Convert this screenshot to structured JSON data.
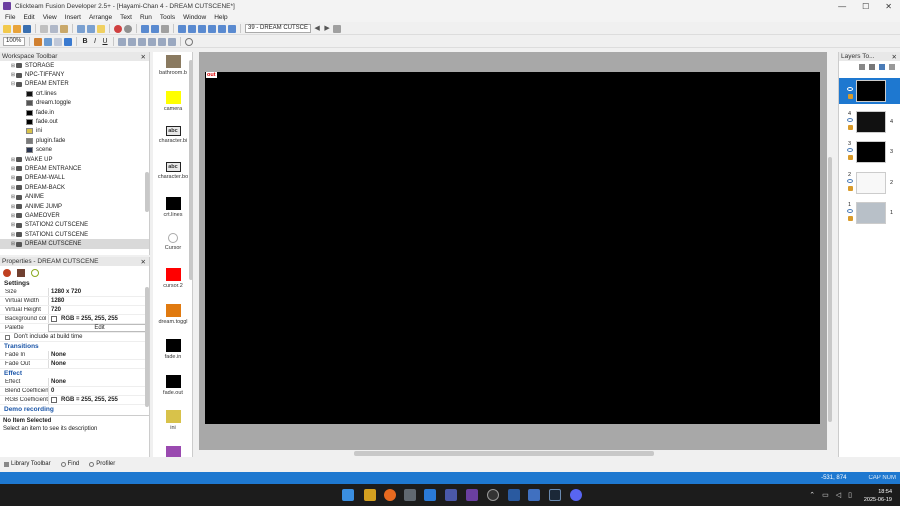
{
  "window": {
    "title": "Clickteam Fusion Developer 2.5+ - [Hayami-Chan 4 - DREAM CUTSCENE*]",
    "min": "—",
    "max": "☐",
    "close": "✕"
  },
  "menu": [
    "File",
    "Edit",
    "View",
    "Insert",
    "Arrange",
    "Text",
    "Run",
    "Tools",
    "Window",
    "Help"
  ],
  "toolbar": {
    "frame_selector": "39 - DREAM CUTSCE",
    "zoom": "100%"
  },
  "workspace": {
    "title": "Workspace Toolbar",
    "items": [
      {
        "label": "STORAGE",
        "type": "frame",
        "exp": "⊞"
      },
      {
        "label": "NPC-TIFFANY",
        "type": "frame",
        "exp": "⊞"
      },
      {
        "label": "DREAM ENTER",
        "type": "frame",
        "exp": "⊟"
      },
      {
        "label": "crt.lines",
        "type": "obj",
        "color": "#111111"
      },
      {
        "label": "dream.toggle",
        "type": "obj",
        "color": "#555555"
      },
      {
        "label": "fade.in",
        "type": "obj",
        "color": "#000000"
      },
      {
        "label": "fade.out",
        "type": "obj",
        "color": "#000000"
      },
      {
        "label": "ini",
        "type": "obj",
        "color": "#d8c24a"
      },
      {
        "label": "plugin.fade",
        "type": "obj",
        "color": "#7a7a7a"
      },
      {
        "label": "scene",
        "type": "obj",
        "color": "#2a3550"
      },
      {
        "label": "WAKE UP",
        "type": "frame",
        "exp": "⊞"
      },
      {
        "label": "DREAM ENTRANCE",
        "type": "frame",
        "exp": "⊞"
      },
      {
        "label": "DREAM-WALL",
        "type": "frame",
        "exp": "⊞"
      },
      {
        "label": "DREAM-BACK",
        "type": "frame",
        "exp": "⊞"
      },
      {
        "label": "ANIME",
        "type": "frame",
        "exp": "⊞"
      },
      {
        "label": "ANIME JUMP",
        "type": "frame",
        "exp": "⊞"
      },
      {
        "label": "GAMEOVER",
        "type": "frame",
        "exp": "⊞"
      },
      {
        "label": "STATION2 CUTSCENE",
        "type": "frame",
        "exp": "⊞"
      },
      {
        "label": "STATION1 CUTSCENE",
        "type": "frame",
        "exp": "⊞"
      },
      {
        "label": "DREAM CUTSCENE",
        "type": "frame",
        "exp": "⊞",
        "selected": true
      }
    ]
  },
  "properties": {
    "title": "Properties - DREAM CUTSCENE",
    "settings_header": "Settings",
    "size_k": "Size",
    "size_v": "1280 x 720",
    "vw_k": "Virtual Width",
    "vw_v": "1280",
    "vh_k": "Virtual Height",
    "vh_v": "720",
    "bg_k": "Background col",
    "bg_v": "RGB = 255, 255, 255",
    "pal_k": "Palette",
    "pal_v": "Edit",
    "include_label": "Don't include at build time",
    "transitions_header": "Transitions",
    "fadein_k": "Fade In",
    "fadein_v": "None",
    "fadeout_k": "Fade Out",
    "fadeout_v": "None",
    "effect_header": "Effect",
    "effect_k": "Effect",
    "effect_v": "None",
    "blend_k": "Blend Coefficient",
    "blend_v": "0",
    "rgb_k": "RGB Coefficient",
    "rgb_v": "RGB = 255, 255, 255",
    "demo_header": "Demo recording",
    "desc_title": "No Item Selected",
    "desc_text": "Select an item to see its description"
  },
  "objects": [
    {
      "label": "bathroom.b",
      "color": "#8a7a60"
    },
    {
      "label": "camera",
      "color": "#ffff00"
    },
    {
      "label": "character.bi",
      "color": "#e8e8e8",
      "text": "abc"
    },
    {
      "label": "character.bo",
      "color": "#e8e8e8",
      "text": "abc"
    },
    {
      "label": "crt.lines",
      "color": "#000000"
    },
    {
      "label": "Cursor",
      "color": "#ffffff"
    },
    {
      "label": "cursor.2",
      "color": "#ff0000"
    },
    {
      "label": "dream.toggl",
      "color": "#e07a10"
    },
    {
      "label": "fade.in",
      "color": "#000000"
    },
    {
      "label": "fade.out",
      "color": "#000000"
    },
    {
      "label": "ini",
      "color": "#d8c24a"
    },
    {
      "label": "",
      "color": "#9a4ab0"
    }
  ],
  "frame_tag": "out",
  "layers": {
    "title": "Layers To...",
    "items": [
      {
        "num": "",
        "num2": "",
        "color": "#000000",
        "selected": true
      },
      {
        "num": "4",
        "num2": "4",
        "color": "#111111"
      },
      {
        "num": "3",
        "num2": "3",
        "color": "#000000"
      },
      {
        "num": "2",
        "num2": "2",
        "color": "#f8f8f8"
      },
      {
        "num": "1",
        "num2": "1",
        "color": "#b8c0c8"
      }
    ]
  },
  "bottom_tabs": {
    "library": "Library Toolbar",
    "find": "Find",
    "profiler": "Profiler"
  },
  "status": {
    "coords": "-531, 874",
    "caps": "CAP NUM"
  },
  "clock": {
    "time": "18:54",
    "date": "2025-06-19"
  }
}
